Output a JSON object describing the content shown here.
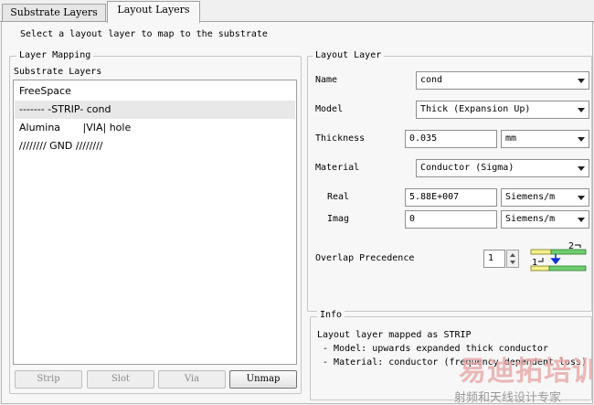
{
  "tabs": [
    {
      "label": "Substrate Layers",
      "active": false
    },
    {
      "label": "Layout Layers",
      "active": true
    }
  ],
  "instruction": "Select a layout layer to map to the substrate",
  "layer_mapping": {
    "title": "Layer Mapping",
    "list_label": "Substrate Layers",
    "items": [
      "FreeSpace",
      "------- -STRIP- cond",
      "Alumina       |VIA| hole",
      "//////// GND ////////"
    ],
    "selected_index": 1,
    "buttons": {
      "strip": "Strip",
      "slot": "Slot",
      "via": "Via",
      "unmap": "Unmap"
    }
  },
  "layout_layer": {
    "title": "Layout Layer",
    "name_label": "Name",
    "name_value": "cond",
    "model_label": "Model",
    "model_value": "Thick (Expansion Up)",
    "thickness_label": "Thickness",
    "thickness_value": "0.035",
    "thickness_unit": "mm",
    "material_label": "Material",
    "material_value": "Conductor (Sigma)",
    "real_label": "Real",
    "real_value": "5.88E+007",
    "real_unit": "Siemens/m",
    "imag_label": "Imag",
    "imag_value": "0",
    "imag_unit": "Siemens/m",
    "overlap_label": "Overlap Precedence",
    "overlap_value": "1",
    "diagram_labels": {
      "top": "2",
      "bottom": "1"
    }
  },
  "info": {
    "title": "Info",
    "line1": "Layout layer mapped as STRIP",
    "line2": " - Model: upwards expanded thick conductor",
    "line3": " - Material: conductor (frequency dependent loss)"
  },
  "watermark": {
    "main": "易迪拓培训",
    "sub": "射频和天线设计专家"
  },
  "colors": {
    "layer_green": "#6fcf6f",
    "layer_yellow": "#f4f08a",
    "arrow_blue": "#1030d0",
    "watermark_main": "#e8a8a8",
    "watermark_sub": "#9a9a9a"
  }
}
